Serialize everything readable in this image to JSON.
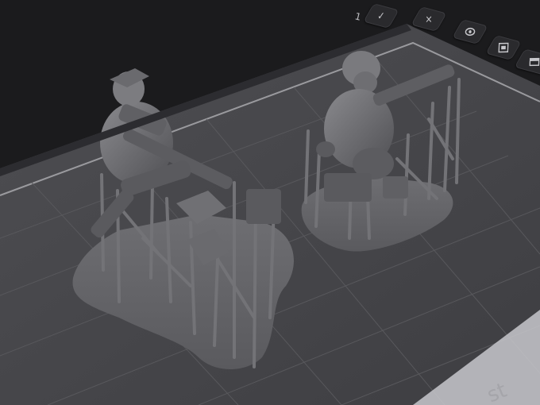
{
  "toolbar": {
    "counter": "1",
    "buttons": [
      {
        "name": "check-icon",
        "glyph": "✓"
      },
      {
        "name": "close-icon",
        "glyph": "×"
      },
      {
        "name": "eye-icon",
        "glyph": ""
      },
      {
        "name": "grid-icon",
        "glyph": ""
      },
      {
        "name": "layer-icon",
        "glyph": ""
      }
    ]
  },
  "corner": {
    "text": "st"
  },
  "colors": {
    "background": "#1b1b1d",
    "plate": "#4a4a4d",
    "grid_line": "#5c5c60",
    "model": "#7a7a7d",
    "model_dark": "#555558",
    "support": "#6c6c70"
  }
}
